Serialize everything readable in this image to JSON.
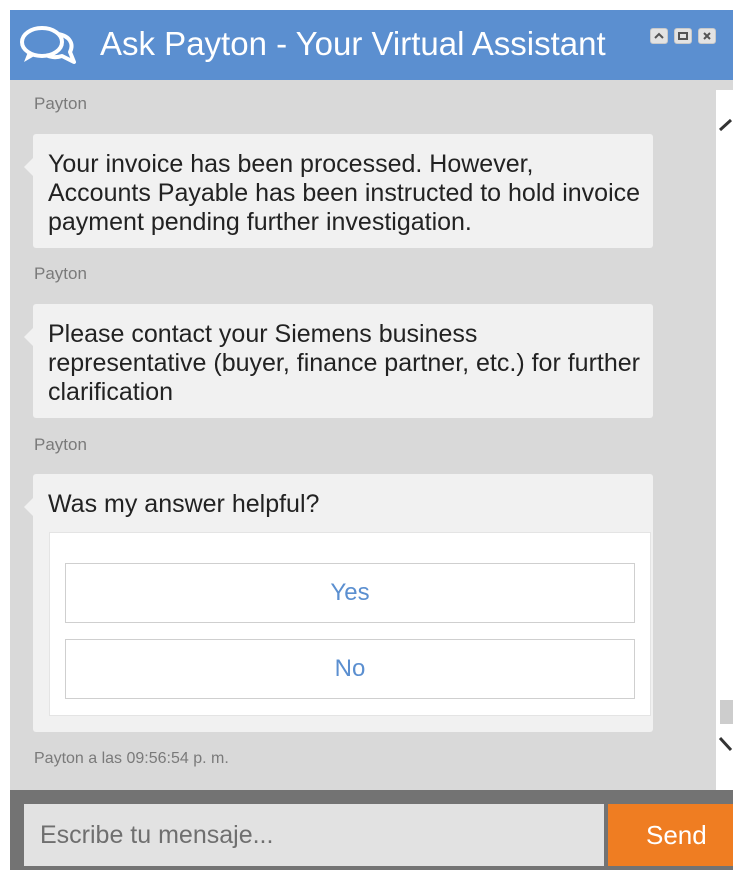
{
  "window": {
    "title": "Ask Payton - Your Virtual Assistant",
    "controls": [
      "minimize-icon",
      "maximize-icon",
      "close-icon"
    ]
  },
  "messages": [
    {
      "sender": "Payton",
      "text": "Your invoice has been processed. However, Accounts Payable has been instructed to hold invoice payment pending further investigation."
    },
    {
      "sender": "Payton",
      "text": "Please contact your Siemens business representative (buyer, finance partner, etc.) for further clarification"
    },
    {
      "sender": "Payton",
      "text": "Was my answer helpful?",
      "options": [
        "Yes",
        "No"
      ]
    }
  ],
  "timestamp": "Payton a las 09:56:54 p. m.",
  "composer": {
    "placeholder": "Escribe tu mensaje...",
    "send_label": "Send"
  },
  "colors": {
    "header": "#5b8fd0",
    "send": "#ef7d22",
    "option_text": "#5b8fd0"
  }
}
